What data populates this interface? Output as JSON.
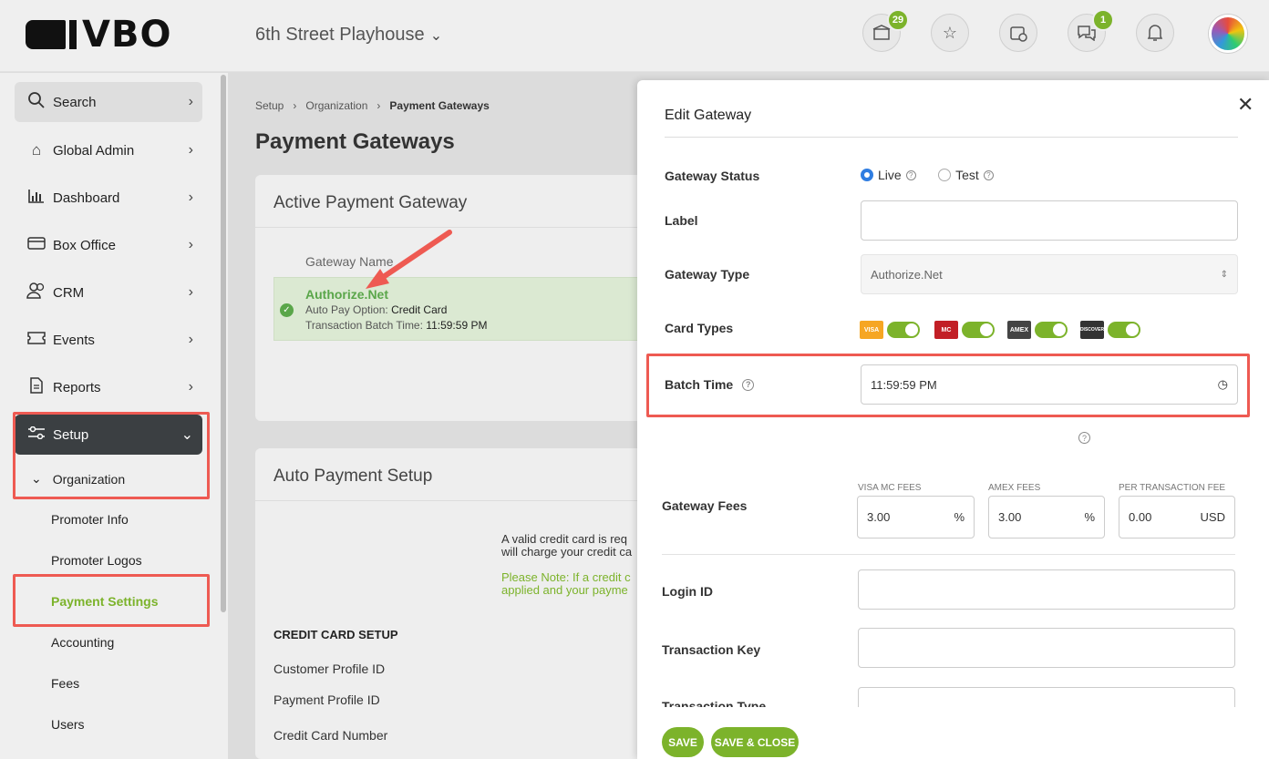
{
  "brand": {
    "logo_text": "VBO",
    "accent": "#7cb32b",
    "highlight": "#ee5a52"
  },
  "header": {
    "venue": "6th Street Playhouse",
    "icons": [
      {
        "name": "package-icon",
        "badge": "29"
      },
      {
        "name": "star-icon",
        "badge": ""
      },
      {
        "name": "calendar-clock-icon",
        "badge": ""
      },
      {
        "name": "chat-icon",
        "badge": "1"
      },
      {
        "name": "bell-icon",
        "badge": ""
      }
    ]
  },
  "sidebar": {
    "items": [
      {
        "label": "Search",
        "icon": "search-icon"
      },
      {
        "label": "Global Admin",
        "icon": "home-icon"
      },
      {
        "label": "Dashboard",
        "icon": "chart-icon"
      },
      {
        "label": "Box Office",
        "icon": "card-icon"
      },
      {
        "label": "CRM",
        "icon": "users-icon"
      },
      {
        "label": "Events",
        "icon": "ticket-icon"
      },
      {
        "label": "Reports",
        "icon": "document-icon"
      },
      {
        "label": "Setup",
        "icon": "sliders-icon"
      }
    ],
    "organization": "Organization",
    "sub_items": [
      "Promoter Info",
      "Promoter Logos",
      "Payment Settings",
      "Accounting",
      "Fees",
      "Users"
    ]
  },
  "main": {
    "breadcrumb": [
      "Setup",
      "Organization",
      "Payment Gateways"
    ],
    "title": "Payment Gateways",
    "active_card": {
      "title": "Active Payment Gateway",
      "column": "Gateway Name",
      "gateway_name": "Authorize.Net",
      "auto_pay_label": "Auto Pay Option:",
      "auto_pay_value": "Credit Card",
      "batch_label": "Transaction Batch Time:",
      "batch_value": "11:59:59 PM"
    },
    "auto_card": {
      "title": "Auto Payment Setup",
      "text1": "A valid credit card is req",
      "text2": "will charge your credit ca",
      "note1": "Please Note: If a credit c",
      "note2": "applied and your payme",
      "section": "CREDIT CARD SETUP",
      "fields": [
        "Customer Profile ID",
        "Payment Profile ID",
        "Credit Card Number"
      ]
    }
  },
  "modal": {
    "title": "Edit Gateway",
    "status_label": "Gateway Status",
    "status_live": "Live",
    "status_test": "Test",
    "label_label": "Label",
    "label_value": "",
    "type_label": "Gateway Type",
    "type_value": "Authorize.Net",
    "card_types_label": "Card Types",
    "cards": [
      "VISA",
      "MC",
      "AMEX",
      "DISCOVER"
    ],
    "batch_label": "Batch Time",
    "batch_value": "11:59:59  PM",
    "fees_label": "Gateway Fees",
    "fee_visa_label": "VISA MC FEES",
    "fee_visa_value": "3.00",
    "fee_amex_label": "AMEX FEES",
    "fee_amex_value": "3.00",
    "fee_tx_label": "PER TRANSACTION FEE",
    "fee_tx_value": "0.00",
    "pct": "%",
    "usd": "USD",
    "login_label": "Login ID",
    "tx_key_label": "Transaction Key",
    "tx_type_label": "Transaction Type",
    "save": "SAVE",
    "save_close": "SAVE & CLOSE"
  }
}
